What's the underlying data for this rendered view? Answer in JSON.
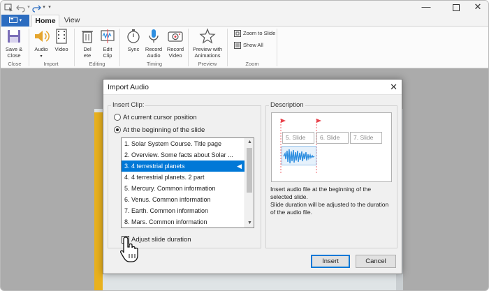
{
  "ribbon": {
    "tabs": [
      "Home",
      "View"
    ],
    "buttons": {
      "save_close": "Save &\nClose",
      "audio": "Audio",
      "video": "Video",
      "delete": "Del\nete",
      "edit_clip": "Edit\nClip",
      "sync": "Sync",
      "record_audio": "Record\nAudio",
      "record_video": "Record\nVideo",
      "preview_animations": "Preview with\nAnimations",
      "zoom_to_slide": "Zoom to Slide",
      "show_all": "Show All"
    },
    "groups": {
      "close": "Close",
      "import": "Import",
      "editing": "Editing",
      "timing": "Timing",
      "preview": "Preview",
      "zoom": "Zoom"
    }
  },
  "dialog": {
    "title": "Import Audio",
    "insert_clip_label": "Insert Clip:",
    "radio_cursor": "At current cursor position",
    "radio_beginning": "At the beginning of the slide",
    "selected_radio": "beginning",
    "slides": [
      "1. Solar System Course. Title page",
      "2. Overview. Some facts about Solar ...",
      "3. 4 terrestrial planets",
      "4. 4 terrestrial planets. 2 part",
      "5. Mercury. Common information",
      "6. Venus. Common information",
      "7. Earth. Common information",
      "8. Mars. Common information"
    ],
    "selected_slide_index": 2,
    "adjust_label": "Adjust slide duration",
    "adjust_checked": true,
    "description_label": "Description",
    "diagram_slides": [
      "5. Slide",
      "6. Slide",
      "7. Slide"
    ],
    "description_text": "Insert audio file at the beginning of the selected slide.\nSlide duration will be adjusted to the duration of the audio file.",
    "insert_button": "Insert",
    "cancel_button": "Cancel"
  },
  "colors": {
    "accent": "#2b6cc0",
    "selection": "#0078d7",
    "flag": "#e8424b",
    "waveform": "#2f8fe0",
    "slide_yellow": "#e9b11e"
  }
}
